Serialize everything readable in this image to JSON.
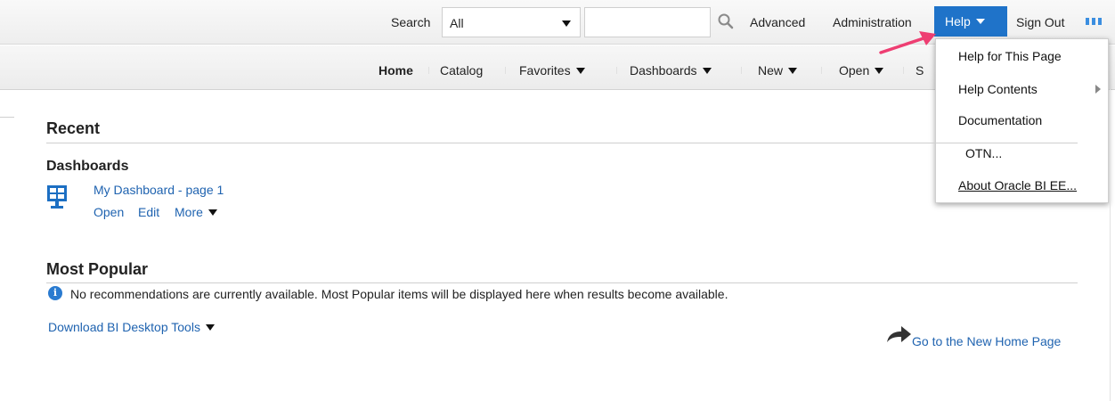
{
  "topbar": {
    "search_label": "Search",
    "search_scope": "All",
    "search_value": "",
    "advanced": "Advanced",
    "administration": "Administration",
    "help": "Help",
    "sign_out": "Sign Out"
  },
  "navbar": {
    "items": [
      {
        "label": "Home",
        "has_menu": false
      },
      {
        "label": "Catalog",
        "has_menu": false
      },
      {
        "label": "Favorites",
        "has_menu": true
      },
      {
        "label": "Dashboards",
        "has_menu": true
      },
      {
        "label": "New",
        "has_menu": true
      },
      {
        "label": "Open",
        "has_menu": true
      },
      {
        "label": "S",
        "has_menu": false
      }
    ]
  },
  "help_menu": {
    "items": [
      {
        "label": "Help for This Page"
      },
      {
        "label": "Help Contents",
        "has_submenu": true
      },
      {
        "label": "Documentation"
      },
      {
        "label": "OTN..."
      },
      {
        "label": "About Oracle BI EE..."
      }
    ]
  },
  "recent": {
    "title": "Recent",
    "dashboards_title": "Dashboards",
    "item": {
      "name": "My Dashboard - page 1",
      "open": "Open",
      "edit": "Edit",
      "more": "More"
    }
  },
  "popular": {
    "title": "Most Popular",
    "info_text": "No recommendations are currently available. Most Popular items will be displayed here when results become available."
  },
  "download_tools": "Download BI Desktop Tools",
  "new_home_link": "Go to the New Home Page",
  "colors": {
    "accent": "#1f73c9",
    "link": "#1f63b0",
    "annotation_arrow": "#ee3e72"
  }
}
